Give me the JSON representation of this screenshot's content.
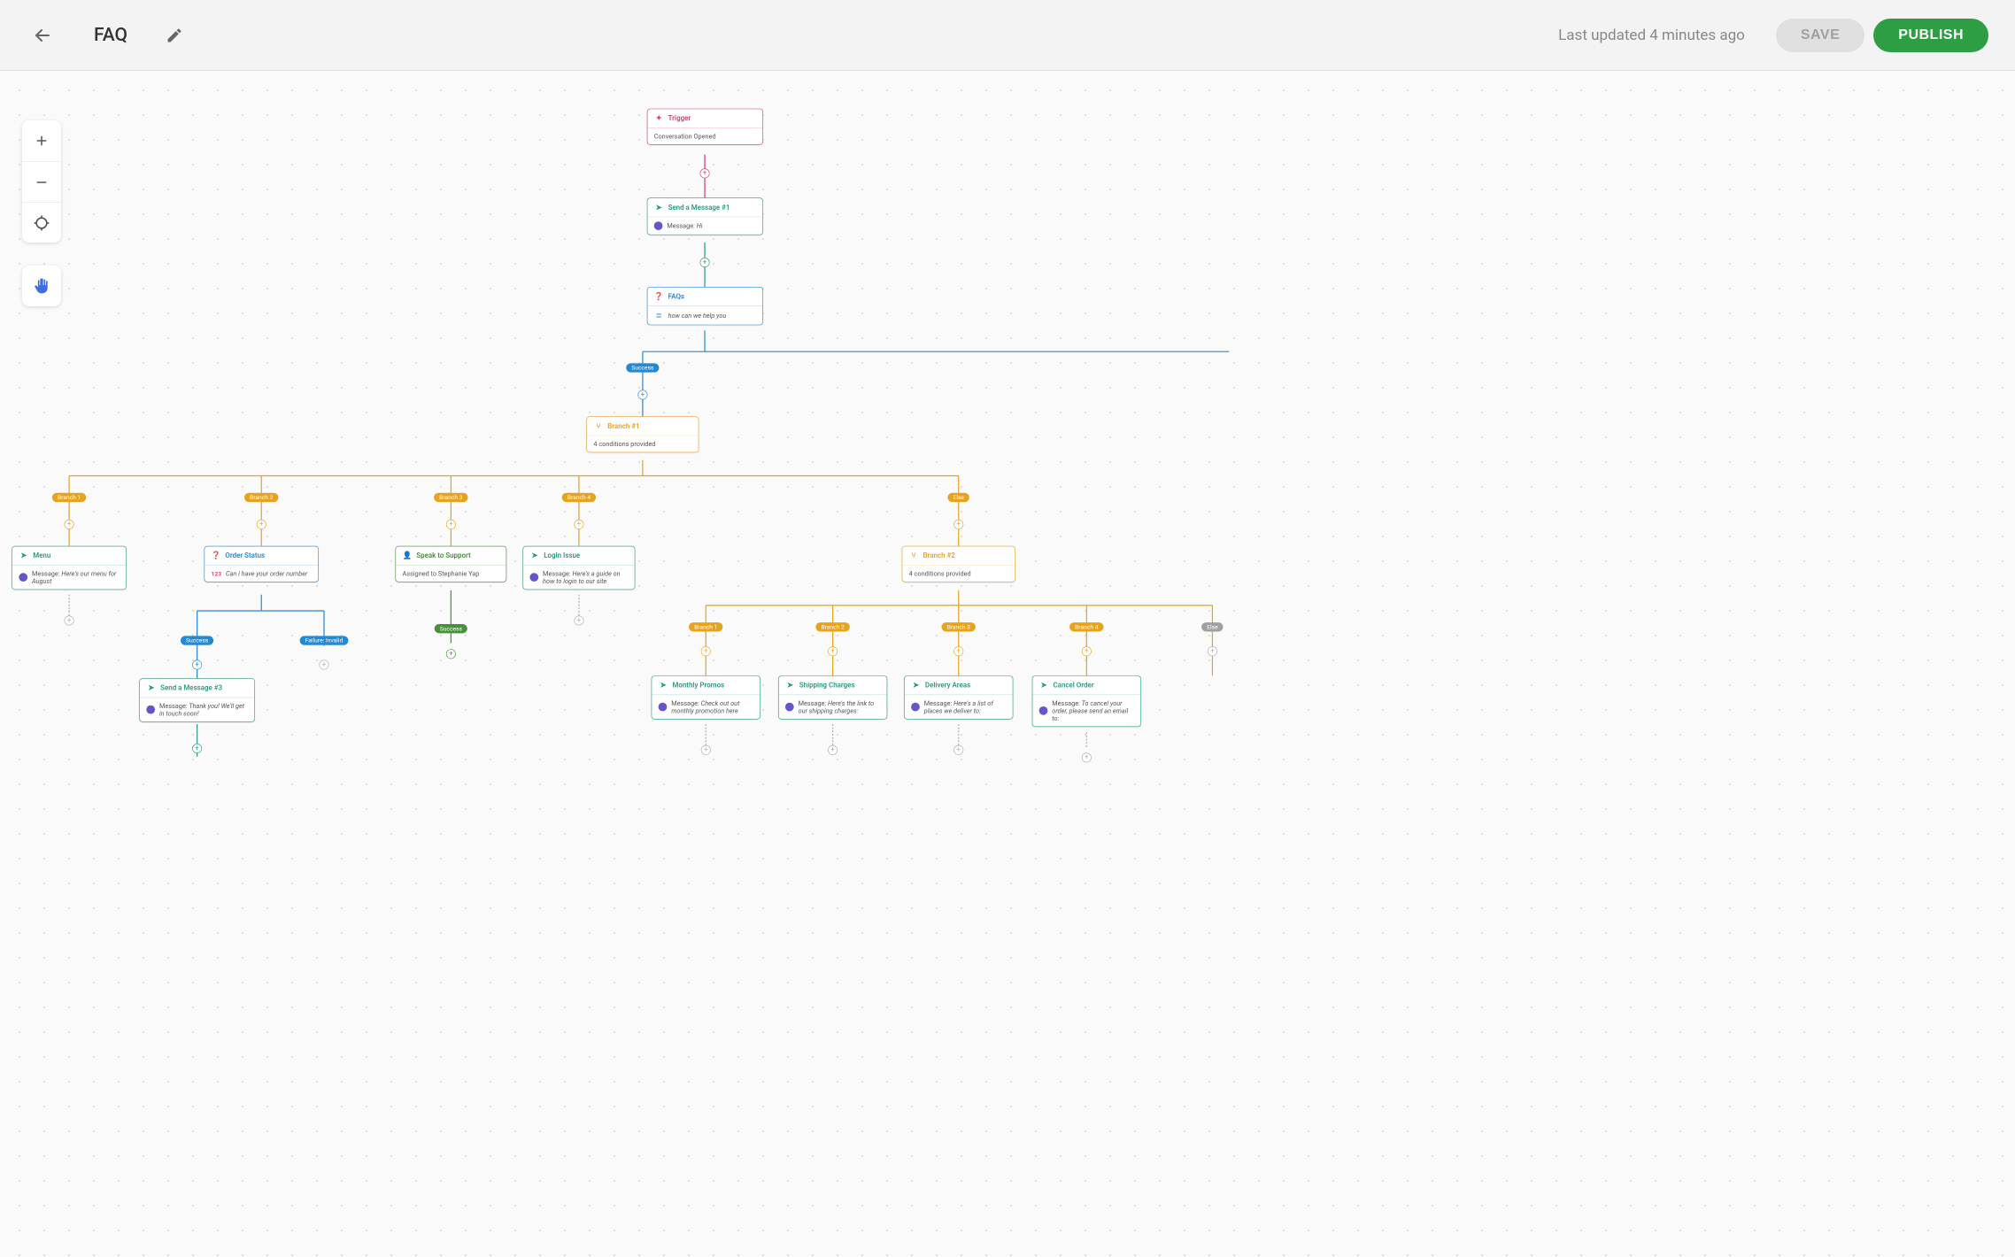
{
  "header": {
    "title": "FAQ",
    "status": "Last updated 4 minutes ago",
    "save_label": "SAVE",
    "publish_label": "PUBLISH"
  },
  "nodes": {
    "trigger": {
      "title": "Trigger",
      "body": "Conversation Opened"
    },
    "send1": {
      "title": "Send a Message #1",
      "label": "Message:",
      "value": "Hi"
    },
    "faqs": {
      "title": "FAQs",
      "value": "how can we help you"
    },
    "branch1": {
      "title": "Branch #1",
      "body": "4 conditions provided"
    },
    "menu": {
      "title": "Menu",
      "label": "Message:",
      "value": "Here's our menu for August"
    },
    "order_status": {
      "title": "Order Status",
      "value": "Can i have your order number"
    },
    "speak_support": {
      "title": "Speak to Support",
      "body": "Assigned to Stephanie Yap"
    },
    "login_issue": {
      "title": "Login Issue",
      "label": "Message:",
      "value": "Here's a guide on how to login to our site"
    },
    "branch2": {
      "title": "Branch #2",
      "body": "4 conditions provided"
    },
    "send3": {
      "title": "Send a Message #3",
      "label": "Message:",
      "value": "Thank you! We'll get in touch soon!"
    },
    "monthly_promos": {
      "title": "Monthly Promos",
      "label": "Message:",
      "value": "Check out out monthly promotion here"
    },
    "shipping": {
      "title": "Shipping Charges",
      "label": "Message:",
      "value": "Here's the link to our shipping charges:"
    },
    "delivery": {
      "title": "Delivery Areas",
      "label": "Message:",
      "value": "Here's a list of places we deliver to:"
    },
    "cancel_order": {
      "title": "Cancel Order",
      "label": "Message:",
      "value": "To cancel your order, please send an email to:"
    }
  },
  "pills": {
    "success": "Success",
    "failure_invalid": "Failure: Invalid",
    "br1": "Branch 1",
    "br2": "Branch 2",
    "br3": "Branch 3",
    "br4": "Branch 4",
    "else": "Else"
  }
}
